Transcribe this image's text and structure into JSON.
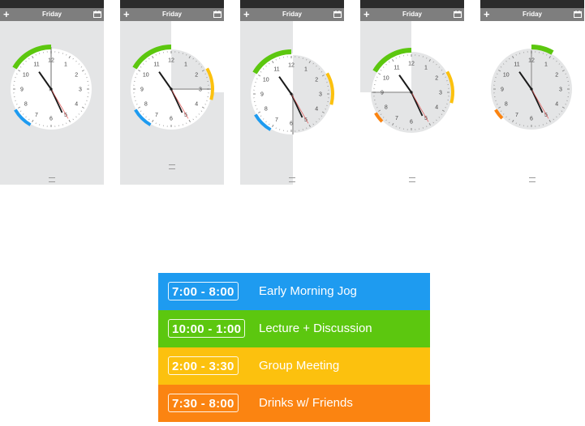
{
  "app": {
    "day_title": "Friday",
    "add_label": "+",
    "handle_label": "="
  },
  "screens": [
    {
      "name": "screen-1",
      "hour_labels": [
        "12",
        "1",
        "2",
        "3",
        "4",
        "5",
        "6",
        "7",
        "8",
        "9",
        "10",
        "11"
      ]
    },
    {
      "name": "screen-2",
      "hour_labels": [
        "12",
        "1",
        "2",
        "3",
        "4",
        "5",
        "6",
        "7",
        "8",
        "9",
        "10",
        "11"
      ]
    },
    {
      "name": "screen-3",
      "hour_labels": [
        "12",
        "1",
        "2",
        "3",
        "4",
        "5",
        "6",
        "7",
        "8",
        "9",
        "10",
        "11"
      ]
    },
    {
      "name": "screen-4",
      "hour_labels": [
        "12",
        "1",
        "2",
        "3",
        "4",
        "5",
        "6",
        "7",
        "8",
        "9",
        "10",
        "11"
      ]
    },
    {
      "name": "screen-5",
      "hour_labels": [
        "12",
        "1",
        "2",
        "3",
        "4",
        "5",
        "6",
        "7",
        "8",
        "9",
        "10",
        "11"
      ]
    }
  ],
  "legend": {
    "items": [
      {
        "time": "7:00 - 8:00",
        "label": "Early Morning Jog",
        "color": "#1e9bf0"
      },
      {
        "time": "10:00 - 1:00",
        "label": "Lecture + Discussion",
        "color": "#5cc70f"
      },
      {
        "time": "2:00 - 3:30",
        "label": "Group Meeting",
        "color": "#fcc10e"
      },
      {
        "time": "7:30 - 8:00",
        "label": "Drinks w/ Friends",
        "color": "#fb8411"
      }
    ]
  },
  "colors": {
    "topbar": "#2b2b2b",
    "titlebar": "#7e7e7e",
    "panel": "#e4e5e6",
    "face": "#ffffff",
    "blue": "#1e9bf0",
    "green": "#5cc70f",
    "yellow": "#fcc10e",
    "orange": "#fb8411"
  }
}
